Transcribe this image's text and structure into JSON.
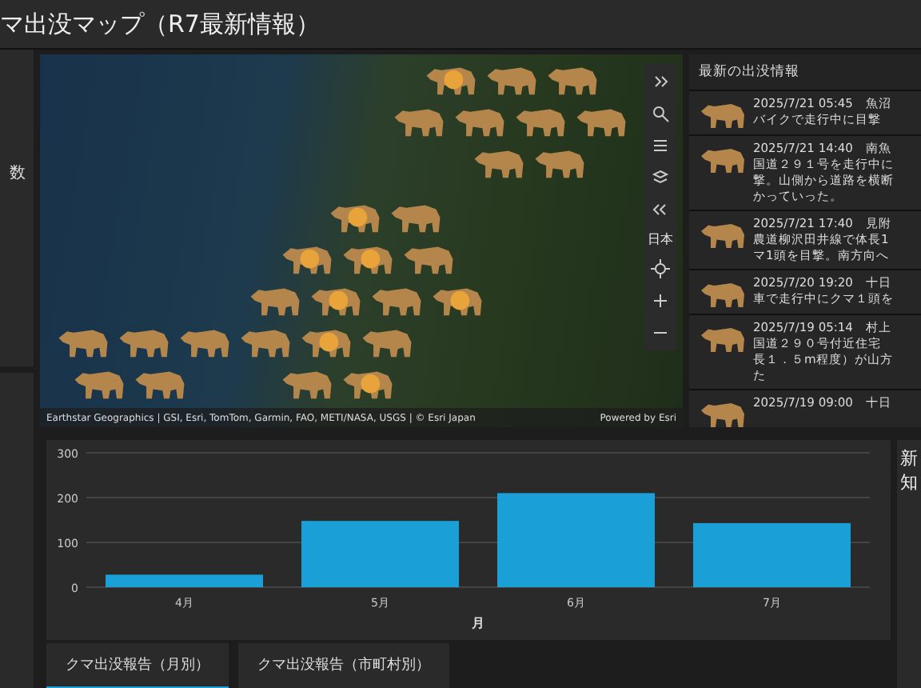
{
  "window": {
    "title": "マ出没マップ（R7最新情報）"
  },
  "left_panel": {
    "fragment": "数"
  },
  "map": {
    "attribution": "Earthstar Geographics | GSI, Esri, TomTom, Garmin, FAO, METI/NASA, USGS | © Esri Japan",
    "powered_by": "Powered by Esri",
    "region_label": "日本"
  },
  "feed": {
    "title": "最新の出没情報",
    "items": [
      {
        "lines": [
          "2025/7/21 05:45　魚沼",
          "バイクで走行中に目撃"
        ]
      },
      {
        "lines": [
          "2025/7/21 14:40　南魚",
          "国道２９１号を走行中に",
          "撃。山側から道路を横断",
          "かっていった。"
        ]
      },
      {
        "lines": [
          "2025/7/21 17:40　見附",
          "農道柳沢田井線で体長1",
          "マ1頭を目撃。南方向へ"
        ]
      },
      {
        "lines": [
          "2025/7/20 19:20　十日",
          "車で走行中にクマ１頭を"
        ]
      },
      {
        "lines": [
          "2025/7/19 05:14　村上",
          "国道２９０号付近住宅",
          "長１．５m程度）が山方",
          "た"
        ]
      },
      {
        "lines": [
          "2025/7/19 09:00　十日"
        ]
      }
    ]
  },
  "chart_data": {
    "type": "bar",
    "xlabel": "月",
    "categories": [
      "4月",
      "5月",
      "6月",
      "7月"
    ],
    "series": [
      {
        "color": "#1a9fd6",
        "values": [
          28,
          148,
          210,
          143
        ]
      }
    ],
    "ylim": [
      0,
      300
    ],
    "yticks": [
      0,
      100,
      200,
      300
    ]
  },
  "tabs": [
    {
      "label": "クマ出没報告（月別）",
      "selected": true
    },
    {
      "label": "クマ出没報告（市町村別）",
      "selected": false
    }
  ],
  "right_panel": {
    "heading_lines": [
      "新",
      "知"
    ]
  }
}
